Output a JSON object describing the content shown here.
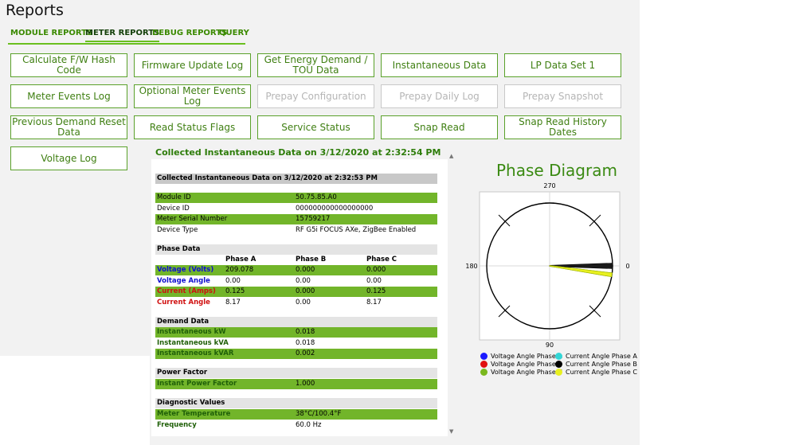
{
  "app": {
    "title": "Reports"
  },
  "tabs": [
    {
      "label": "MODULE REPORTS"
    },
    {
      "label": "METER REPORTS"
    },
    {
      "label": "DEBUG REPORTS"
    },
    {
      "label": "QUERY"
    }
  ],
  "buttons": [
    {
      "label": "Calculate F/W Hash Code"
    },
    {
      "label": "Firmware Update Log"
    },
    {
      "label": "Get Energy Demand / TOU Data"
    },
    {
      "label": "Instantaneous Data"
    },
    {
      "label": "LP Data Set 1"
    },
    {
      "label": "Meter Events Log"
    },
    {
      "label": "Optional Meter Events Log"
    },
    {
      "label": "Prepay Configuration"
    },
    {
      "label": "Prepay Daily Log"
    },
    {
      "label": "Prepay Snapshot"
    },
    {
      "label": "Previous Demand Reset Data"
    },
    {
      "label": "Read Status Flags"
    },
    {
      "label": "Service Status"
    },
    {
      "label": "Snap Read"
    },
    {
      "label": "Snap Read History Dates"
    },
    {
      "label": "Voltage Log"
    }
  ],
  "report": {
    "heading": "Collected Instantaneous Data on 3/12/2020 at 2:32:54 PM",
    "inner_heading": "Collected Instantaneous Data on 3/12/2020 at 2:32:53 PM",
    "info": [
      {
        "label": "Module ID",
        "value": "50.75.85.A0"
      },
      {
        "label": "Device ID",
        "value": "000000000000000000"
      },
      {
        "label": "Meter Serial Number",
        "value": "15759217"
      },
      {
        "label": "Device Type",
        "value": "RF G5i FOCUS AXe, ZigBee Enabled"
      }
    ],
    "phase_section": "Phase Data",
    "phase_cols": [
      "Phase A",
      "Phase B",
      "Phase C"
    ],
    "phase_rows": [
      {
        "label": "Voltage (Volts)",
        "a": "209.078",
        "b": "0.000",
        "c": "0.000"
      },
      {
        "label": "Voltage Angle",
        "a": "0.00",
        "b": "0.00",
        "c": "0.00"
      },
      {
        "label": "Current (Amps)",
        "a": "0.125",
        "b": "0.000",
        "c": "0.125"
      },
      {
        "label": "Current Angle",
        "a": "8.17",
        "b": "0.00",
        "c": "8.17"
      }
    ],
    "demand_section": "Demand Data",
    "demand_rows": [
      {
        "label": "Instantaneous kW",
        "value": "0.018"
      },
      {
        "label": "Instantaneous kVA",
        "value": "0.018"
      },
      {
        "label": "Instantaneous kVAR",
        "value": "0.002"
      }
    ],
    "pf_section": "Power Factor",
    "pf_rows": [
      {
        "label": "Instant Power Factor",
        "value": "1.000"
      }
    ],
    "diag_section": "Diagnostic Values",
    "diag_rows": [
      {
        "label": "Meter Temperature",
        "value": "38°C/100.4°F"
      },
      {
        "label": "Frequency",
        "value": "60.0 Hz"
      }
    ]
  },
  "phase_diagram": {
    "title": "Phase Diagram",
    "labels": {
      "top": "270",
      "left": "180",
      "right": "0",
      "bottom": "90"
    },
    "vectors": [
      {
        "name": "Voltage Angle Phase A",
        "angle_deg": 0.0,
        "magnitude": 1.0,
        "color": "#1a1aff"
      },
      {
        "name": "Voltage Angle Phase B",
        "angle_deg": 0.0,
        "magnitude": 0.0,
        "color": "#e01010"
      },
      {
        "name": "Voltage Angle Phase C",
        "angle_deg": 0.0,
        "magnitude": 0.0,
        "color": "#7ab81e"
      },
      {
        "name": "Current Angle Phase A",
        "angle_deg": 8.17,
        "magnitude": 1.0,
        "color": "#33d6d6"
      },
      {
        "name": "Current Angle Phase B",
        "angle_deg": 0.0,
        "magnitude": 0.0,
        "color": "#000000"
      },
      {
        "name": "Current Angle Phase C",
        "angle_deg": 8.17,
        "magnitude": 1.0,
        "color": "#e8f020"
      }
    ],
    "legend": [
      {
        "label": "Voltage Angle Phase A",
        "color": "#1a1aff"
      },
      {
        "label": "Current Angle Phase A",
        "color": "#33d6d6"
      },
      {
        "label": "Voltage Angle Phase B",
        "color": "#e01010"
      },
      {
        "label": "Current Angle Phase B",
        "color": "#000000"
      },
      {
        "label": "Voltage Angle Phase C",
        "color": "#7ab81e"
      },
      {
        "label": "Current Angle Phase C",
        "color": "#e8f020"
      }
    ]
  }
}
